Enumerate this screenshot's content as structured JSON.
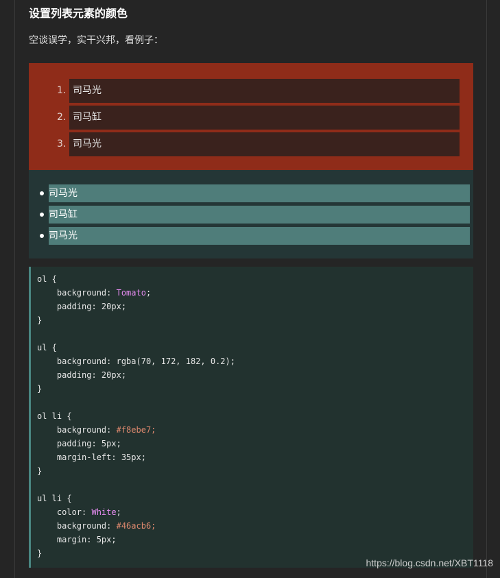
{
  "heading": "设置列表元素的颜色",
  "intro": "空谈误学，实干兴邦，看例子：",
  "ol_items": [
    {
      "num": "1.",
      "text": "司马光"
    },
    {
      "num": "2.",
      "text": "司马缸"
    },
    {
      "num": "3.",
      "text": "司马光"
    }
  ],
  "ul_items": [
    "司马光",
    "司马缸",
    "司马光"
  ],
  "colors": {
    "ol_background": "#8f2c19",
    "ol_item_background": "#3a221d",
    "ul_background": "#243636",
    "ul_item_background": "#4f7d7a",
    "code_background": "#22322f",
    "code_border": "#4a8782"
  },
  "code": [
    [
      {
        "t": "ol {",
        "c": "sel"
      }
    ],
    [
      {
        "t": "    background: ",
        "c": "prop"
      },
      {
        "t": "Tomato",
        "c": "kw"
      },
      {
        "t": ";",
        "c": "prop"
      }
    ],
    [
      {
        "t": "    padding: 20px;",
        "c": "prop"
      }
    ],
    [
      {
        "t": "}",
        "c": "sel"
      }
    ],
    [
      {
        "t": "",
        "c": "prop"
      }
    ],
    [
      {
        "t": "ul {",
        "c": "sel"
      }
    ],
    [
      {
        "t": "    background: rgba(70, 172, 182, 0.2);",
        "c": "prop"
      }
    ],
    [
      {
        "t": "    padding: 20px;",
        "c": "prop"
      }
    ],
    [
      {
        "t": "}",
        "c": "sel"
      }
    ],
    [
      {
        "t": "",
        "c": "prop"
      }
    ],
    [
      {
        "t": "ol li {",
        "c": "sel"
      }
    ],
    [
      {
        "t": "    background: ",
        "c": "prop"
      },
      {
        "t": "#f8ebe7;",
        "c": "hex"
      }
    ],
    [
      {
        "t": "    padding: 5px;",
        "c": "prop"
      }
    ],
    [
      {
        "t": "    margin-left: 35px;",
        "c": "prop"
      }
    ],
    [
      {
        "t": "}",
        "c": "sel"
      }
    ],
    [
      {
        "t": "",
        "c": "prop"
      }
    ],
    [
      {
        "t": "ul li {",
        "c": "sel"
      }
    ],
    [
      {
        "t": "    color: ",
        "c": "prop"
      },
      {
        "t": "White",
        "c": "kw"
      },
      {
        "t": ";",
        "c": "prop"
      }
    ],
    [
      {
        "t": "    background: ",
        "c": "prop"
      },
      {
        "t": "#46acb6;",
        "c": "hex"
      }
    ],
    [
      {
        "t": "    margin: 5px;",
        "c": "prop"
      }
    ],
    [
      {
        "t": "}",
        "c": "sel"
      }
    ]
  ],
  "watermark": "https://blog.csdn.net/XBT1118"
}
